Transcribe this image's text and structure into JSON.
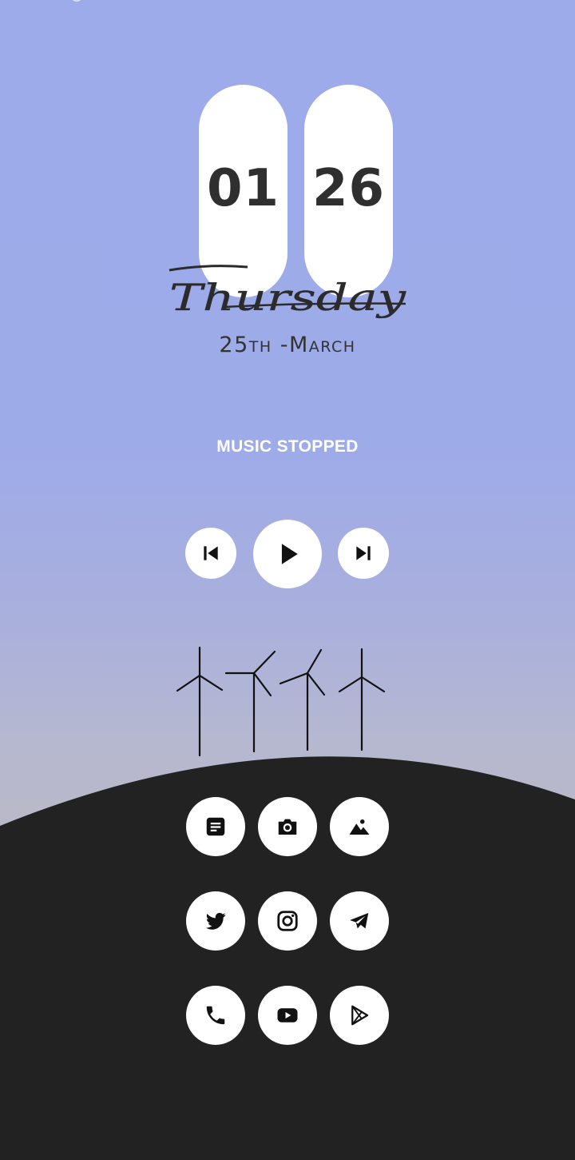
{
  "clock": {
    "hour": "01",
    "minute": "26"
  },
  "weekday": "Thursday",
  "date": "25th -March",
  "music": {
    "status": "MUSIC STOPPED",
    "controls": [
      "previous-icon",
      "play-icon",
      "next-icon"
    ]
  },
  "apps": [
    [
      "notes-icon",
      "camera-icon",
      "gallery-icon"
    ],
    [
      "twitter-icon",
      "instagram-icon",
      "telegram-icon"
    ],
    [
      "phone-icon",
      "youtube-icon",
      "play-store-icon"
    ]
  ],
  "colors": {
    "sky_top": "#9dabea",
    "sky_bottom": "#bab9c8",
    "hill": "#222222",
    "pill": "#ffffff",
    "text_dark": "#2f2f2f",
    "text_light": "#ffffff"
  }
}
